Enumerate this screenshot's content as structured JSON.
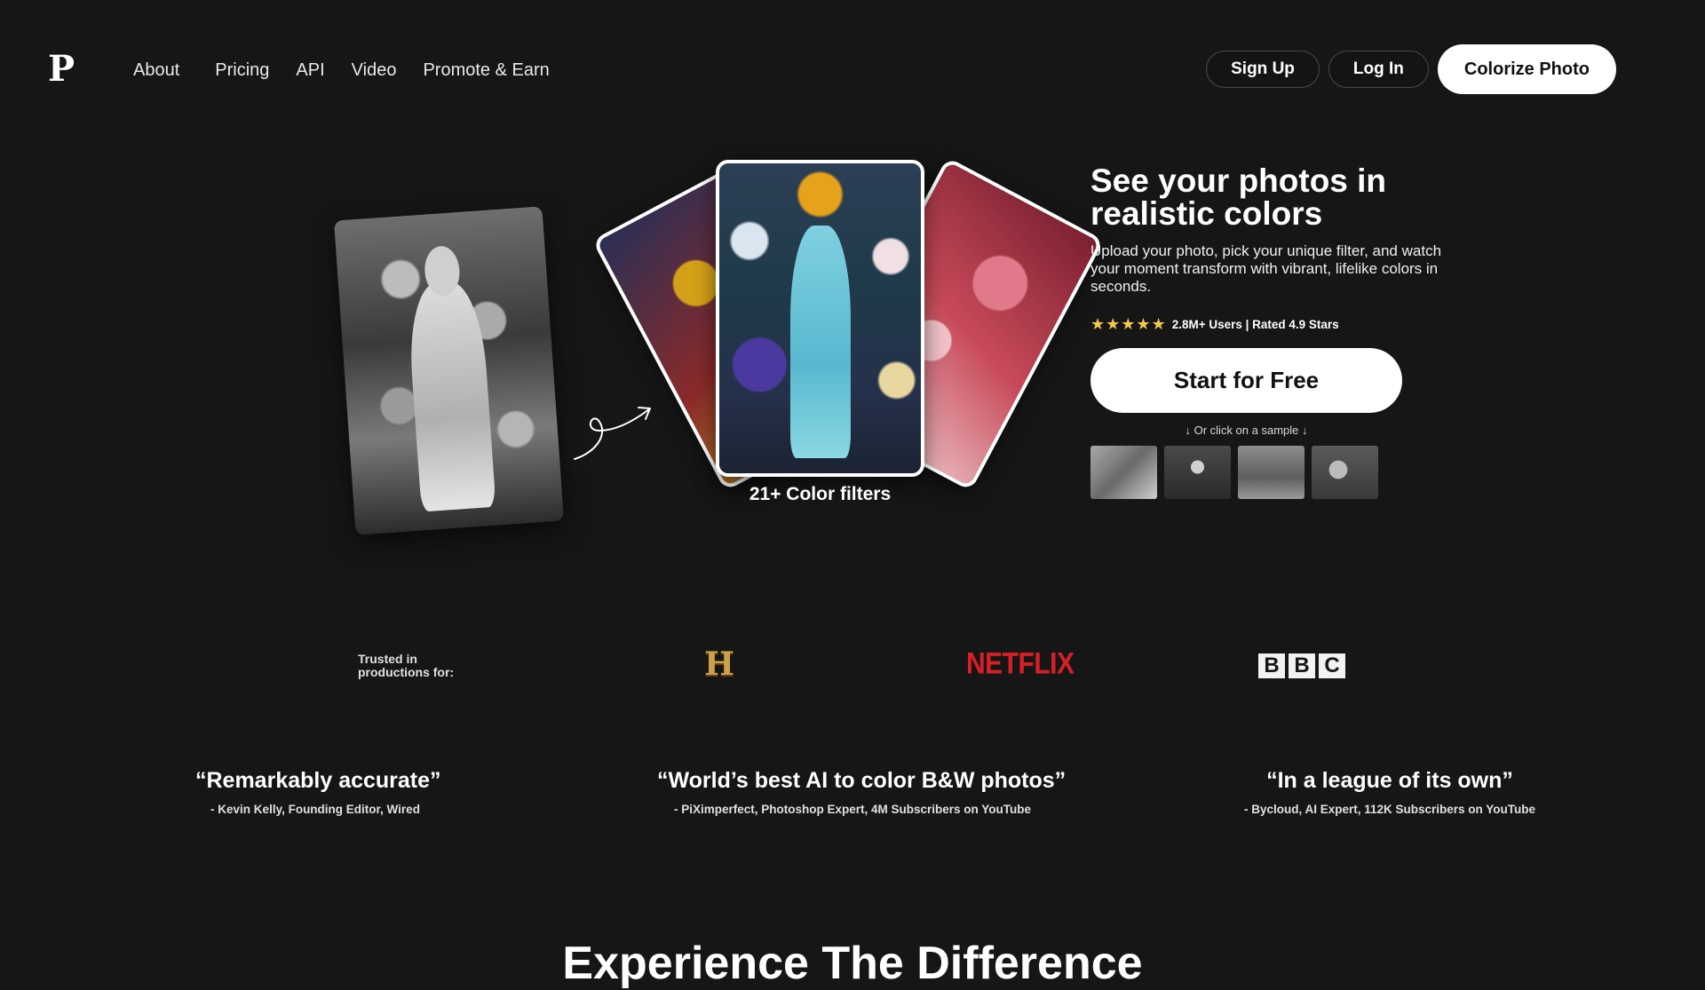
{
  "nav": {
    "logo": "P",
    "links": [
      "About",
      "Pricing",
      "API",
      "Video",
      "Promote & Earn"
    ],
    "signup": "Sign Up",
    "login": "Log In",
    "colorize": "Colorize Photo"
  },
  "hero": {
    "caption": "21+ Color filters",
    "title": "See your photos in realistic colors",
    "subtitle": "Upload your photo, pick your unique filter, and watch your moment transform with vibrant, lifelike colors in seconds.",
    "stars": "★★★★★",
    "rating_text": "2.8M+ Users | Rated 4.9 Stars",
    "cta": "Start for Free",
    "sample_hint": "↓ Or click on a sample ↓"
  },
  "trusted": {
    "label": "Trusted in productions for:",
    "history_logo": "H",
    "netflix_logo": "NETFLIX",
    "bbc_letters": [
      "B",
      "B",
      "C"
    ]
  },
  "quotes": [
    {
      "text": "“Remarkably accurate”",
      "by": "- Kevin Kelly, Founding Editor, Wired"
    },
    {
      "text": "“World’s best AI to color B&W photos”",
      "by": "- PiXimperfect, Photoshop Expert, 4M Subscribers on YouTube"
    },
    {
      "text": "“In a league of its own”",
      "by": "- Bycloud, AI Expert, 112K Subscribers on YouTube"
    }
  ],
  "section_title": "Experience The Difference",
  "icons": {
    "arrow": "curly-arrow-icon",
    "star": "star-icon"
  },
  "colors": {
    "background": "#161616",
    "star": "#f2c94c",
    "netflix": "#d81f26",
    "history": "#c9a24a"
  }
}
